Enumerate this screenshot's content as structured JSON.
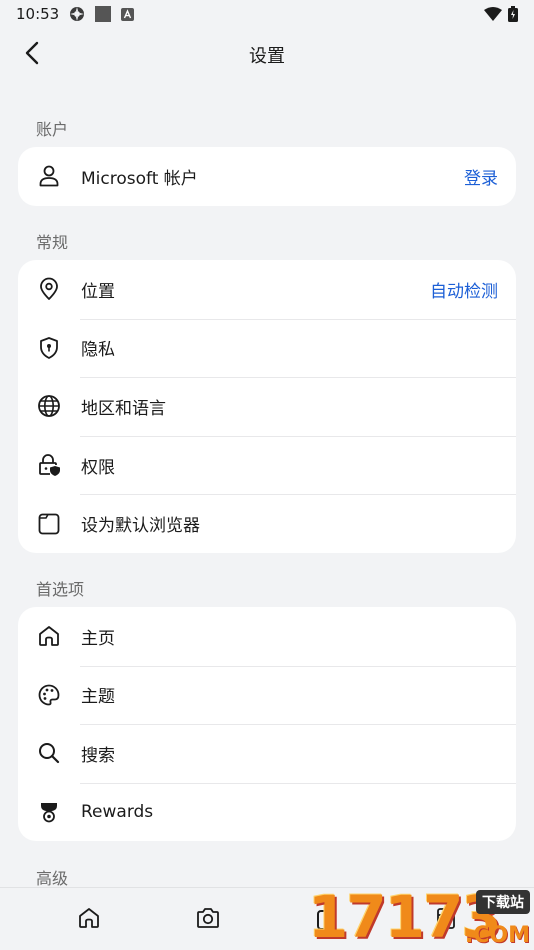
{
  "status_bar": {
    "time": "10:53",
    "left_icons": [
      "settings-cog-icon",
      "square-app-icon",
      "font-a-icon"
    ],
    "right_icons": [
      "wifi-icon",
      "battery-icon"
    ]
  },
  "header": {
    "title": "设置",
    "back_icon": "chevron-left-icon"
  },
  "sections": {
    "account": {
      "label": "账户",
      "items": [
        {
          "label": "Microsoft 帐户",
          "value": "登录",
          "icon": "person-icon"
        }
      ]
    },
    "general": {
      "label": "常规",
      "items": [
        {
          "label": "位置",
          "value": "自动检测",
          "icon": "location-pin-icon"
        },
        {
          "label": "隐私",
          "icon": "shield-lock-icon"
        },
        {
          "label": "地区和语言",
          "icon": "globe-icon"
        },
        {
          "label": "权限",
          "icon": "lock-shield-icon"
        },
        {
          "label": "设为默认浏览器",
          "icon": "browser-window-icon"
        }
      ]
    },
    "preferences": {
      "label": "首选项",
      "items": [
        {
          "label": "主页",
          "icon": "home-icon"
        },
        {
          "label": "主题",
          "icon": "palette-icon"
        },
        {
          "label": "搜索",
          "icon": "search-icon"
        },
        {
          "label": "Rewards",
          "icon": "trophy-icon"
        }
      ]
    },
    "advanced": {
      "label": "高级"
    }
  },
  "bottom_bar": {
    "tab_count": "0",
    "icons": [
      "home-icon",
      "camera-icon",
      "tabs-icon",
      "wallet-icon"
    ]
  },
  "watermark": {
    "digits": "17173",
    "badge": "下载站",
    "domain": ".COM"
  },
  "colors": {
    "accent": "#1c5fd6",
    "background": "#f2f3f5",
    "card": "#ffffff",
    "section_label": "#6b6b6b"
  }
}
